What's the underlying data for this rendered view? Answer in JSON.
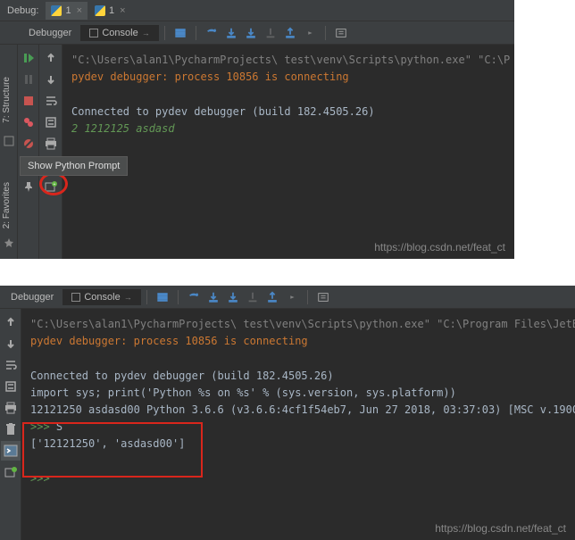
{
  "screenshot1": {
    "topbar": {
      "debug_label": "Debug:",
      "tabs": [
        {
          "label": "1"
        },
        {
          "label": "1"
        }
      ]
    },
    "subtabs": {
      "debugger_label": "Debugger",
      "console_label": "Console",
      "pin_glyph": "→"
    },
    "side": {
      "structure_label": "7: Structure",
      "favorites_label": "2: Favorites"
    },
    "tooltip": "Show Python Prompt",
    "console": {
      "line1": "\"C:\\Users\\alan1\\PycharmProjects\\ test\\venv\\Scripts\\python.exe\" \"C:\\P",
      "line2": "pydev debugger: process 10856 is connecting",
      "line3": "Connected to pydev debugger (build 182.4505.26)",
      "line4": "2 1212125 asdasd"
    },
    "watermark": "https://blog.csdn.net/feat_ct"
  },
  "screenshot2": {
    "subtabs": {
      "debugger_label": "Debugger",
      "console_label": "Console",
      "pin_glyph": "→"
    },
    "console": {
      "line1": "\"C:\\Users\\alan1\\PycharmProjects\\ test\\venv\\Scripts\\python.exe\" \"C:\\Program Files\\JetB",
      "line2": "pydev debugger: process 10856 is connecting",
      "line3": "Connected to pydev debugger (build 182.4505.26)",
      "line4": "import sys; print('Python %s on %s' % (sys.version, sys.platform))",
      "line5": "12121250 asdasd00 Python 3.6.6 (v3.6.6:4cf1f54eb7, Jun 27 2018, 03:37:03) [MSC v.1900 ",
      "prompt1": ">>>",
      "input1": " S",
      "result1": "['12121250', 'asdasd00']",
      "prompt2": ">>>"
    },
    "watermark": "https://blog.csdn.net/feat_ct"
  }
}
